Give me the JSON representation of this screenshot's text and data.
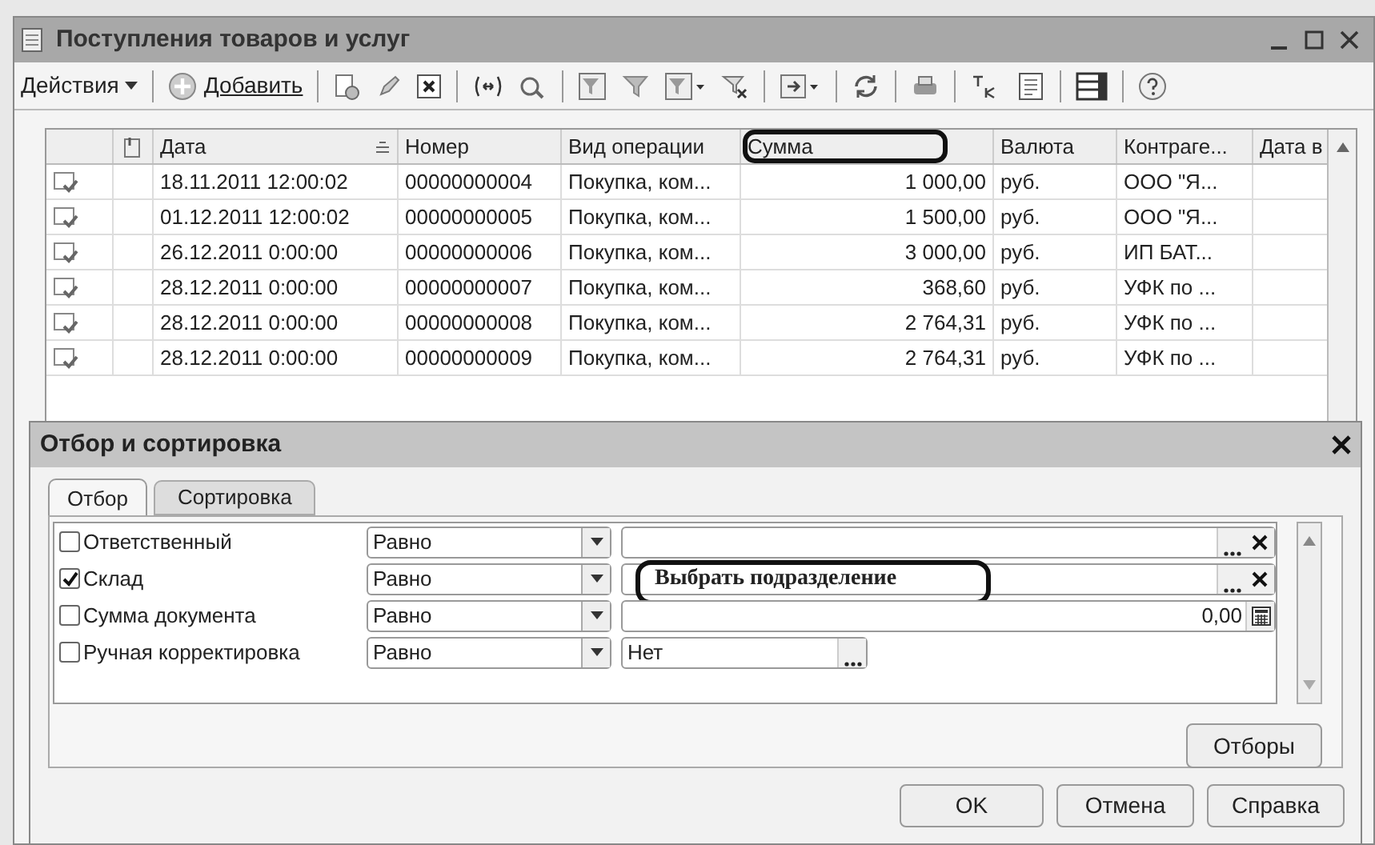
{
  "window": {
    "title": "Поступления товаров и услуг"
  },
  "toolbar": {
    "actions": "Действия",
    "add": "Добавить"
  },
  "table": {
    "columns": [
      "Дата",
      "Номер",
      "Вид операции",
      "Сумма",
      "Валюта",
      "Контраге...",
      "Дата в"
    ],
    "rows": [
      {
        "cells": [
          "18.11.2011 12:00:02",
          "00000000004",
          "Покупка, ком...",
          "1 000,00",
          "руб.",
          "ООО \"Я..."
        ]
      },
      {
        "cells": [
          "01.12.2011 12:00:02",
          "00000000005",
          "Покупка, ком...",
          "1 500,00",
          "руб.",
          "ООО \"Я..."
        ]
      },
      {
        "cells": [
          "26.12.2011 0:00:00",
          "00000000006",
          "Покупка, ком...",
          "3 000,00",
          "руб.",
          "ИП БАТ..."
        ]
      },
      {
        "cells": [
          "28.12.2011 0:00:00",
          "00000000007",
          "Покупка, ком...",
          "368,60",
          "руб.",
          "УФК по ..."
        ]
      },
      {
        "cells": [
          "28.12.2011 0:00:00",
          "00000000008",
          "Покупка, ком...",
          "2 764,31",
          "руб.",
          "УФК по ..."
        ]
      },
      {
        "cells": [
          "28.12.2011 0:00:00",
          "00000000009",
          "Покупка, ком...",
          "2 764,31",
          "руб.",
          "УФК по ..."
        ]
      }
    ]
  },
  "dialog": {
    "title": "Отбор и сортировка",
    "tabs": [
      {
        "label": "Отбор",
        "selected": true
      },
      {
        "label": "Сортировка",
        "selected": false
      }
    ],
    "filters": [
      {
        "label": "Ответственный",
        "checked": false,
        "comparison": "Равно",
        "kind": "reference"
      },
      {
        "label": "Склад",
        "checked": true,
        "comparison": "Равно",
        "kind": "reference",
        "value": "Выбрать подразделение"
      },
      {
        "label": "Сумма документа",
        "checked": false,
        "comparison": "Равно",
        "kind": "number",
        "value": "0,00"
      },
      {
        "label": "Ручная корректировка",
        "checked": false,
        "comparison": "Равно",
        "kind": "boolean",
        "value": "Нет"
      }
    ],
    "filters_button": "Отборы",
    "buttons": [
      "OK",
      "Отмена",
      "Справка"
    ]
  }
}
